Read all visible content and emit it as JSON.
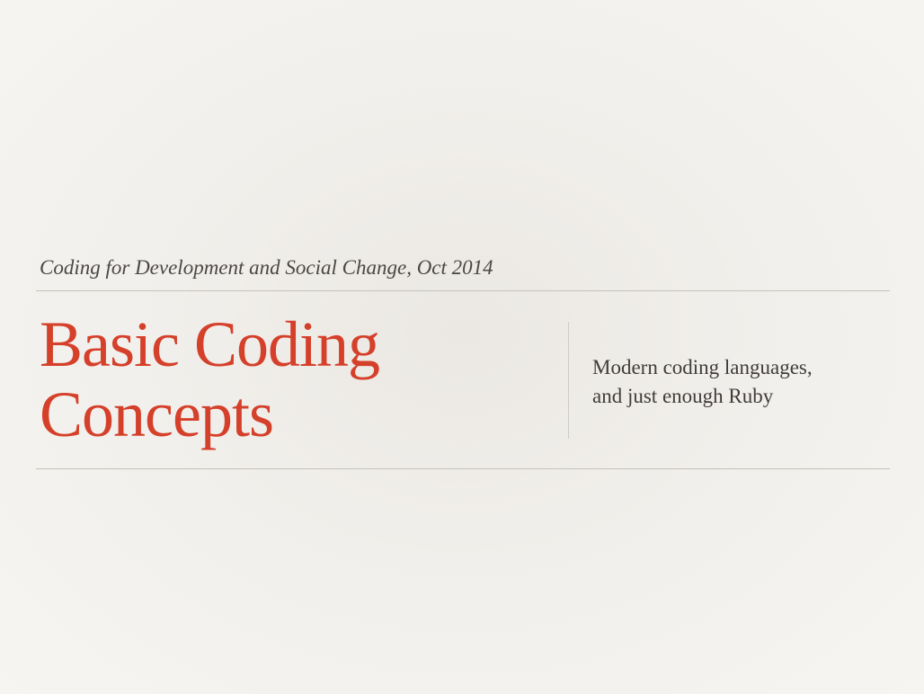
{
  "slide": {
    "kicker": "Coding for Development and Social Change, Oct 2014",
    "title_lines": [
      "Basic Coding",
      "Concepts"
    ],
    "subtitle_lines": [
      "Modern coding languages,",
      "and just enough Ruby"
    ]
  },
  "colors": {
    "title": "#d5402b",
    "text": "#3f3c3a",
    "rule": "#c5c1bb",
    "background": "#f4f2ee"
  }
}
